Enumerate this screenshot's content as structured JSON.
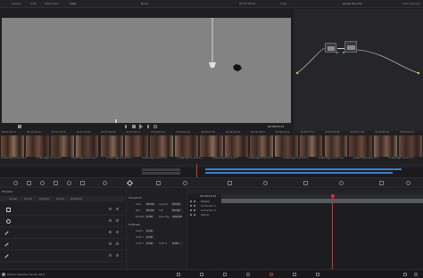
{
  "topbar": {
    "left_tabs": [
      "Gallery",
      "LUTs",
      "Media Pool",
      "Clips"
    ],
    "center_title": "Node",
    "viewer_timecode": "00:57:58:12",
    "right_center": "Clips",
    "node_title": "Group Pre-Clip",
    "corner_label": "Color Groups"
  },
  "viewer": {
    "timecode": "00:58:23:21"
  },
  "thumbnails": {
    "top_labels": [
      "00:57:28:13",
      "00:57:31:22",
      "00:57:35:15",
      "00:57:41:09",
      "00:57:49:05",
      "00:57:55:17",
      "00:58:00:22",
      "00:58:04:01",
      "00:58:07:18",
      "00:58:12:20",
      "00:58:18:04",
      "00:58:23:21",
      "00:58:27:11",
      "00:58:33:08",
      "00:58:37:16",
      "00:58:40:03",
      "00:58:44:21"
    ],
    "bottom_labels": [
      "H.264 High 4:2:2 L5.1",
      "H.264 High 4:2:2 L5.1",
      "H.264 High 4:2:2 L5.1",
      "H.264 High 4:2:2 L5.1",
      "H.264 High 4:2:2 L5.1",
      "H.264 High 4:2:2 L5.1",
      "H.264 High 4:2:2 L5.1",
      "H.264 High 4:2:2 L5.1",
      "H.264 High 4:2:2 L5.1",
      "H.264 High 4:2:2 L5.1",
      "H.264 High 4:2:2 L5.1",
      "H.264 High 4:2:2 L5.1"
    ]
  },
  "window_panel": {
    "title": "Window",
    "tool_labels": [
      "Linear",
      "Circle",
      "Polygon",
      "Curve",
      "Gradient"
    ]
  },
  "transform_panel": {
    "transform_title": "Transform",
    "transform_fields": [
      {
        "label": "Size",
        "value": "50.00",
        "label2": "Aspect",
        "value2": "50.00"
      },
      {
        "label": "Pan",
        "value": "50.00",
        "label2": "Tilt",
        "value2": "50.00"
      },
      {
        "label": "Rotate",
        "value": "0.00",
        "label2": "Opacity",
        "value2": "100.00"
      }
    ],
    "softness_title": "Softness",
    "softness_fields": [
      {
        "label": "Soft 1",
        "value": "0.00"
      },
      {
        "label": "Soft 2",
        "value": "0.00"
      },
      {
        "label": "Soft 3",
        "value": "0.00",
        "label2": "Soft 4",
        "value2": "0.00"
      }
    ]
  },
  "keyframes": {
    "timecode": "00:58:23:21",
    "tracks": [
      "Master",
      "Corrector 1",
      "Corrector 2",
      "Sizing"
    ],
    "playhead_fraction": 0.5
  },
  "status": {
    "app_name": "DaVinci Resolve Studio 18.6"
  },
  "colors": {
    "playhead": "#d8303a",
    "accent_blue": "#3a7fd0",
    "node_link": "#cfcfcf"
  }
}
